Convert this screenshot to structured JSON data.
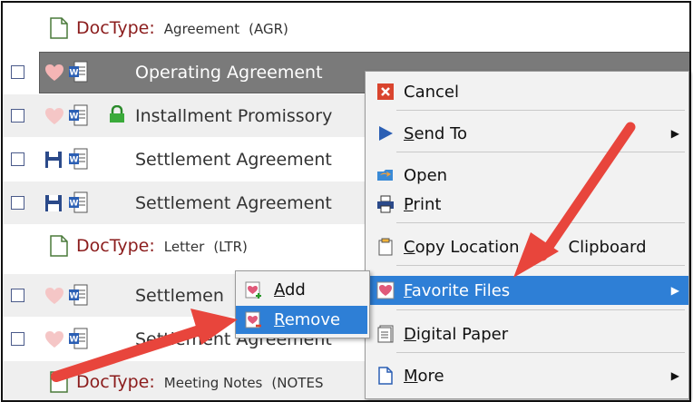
{
  "doctypes": [
    {
      "prefix": "DocType:",
      "name": "Agreement",
      "code": "(AGR)"
    },
    {
      "prefix": "DocType:",
      "name": "Letter",
      "code": "(LTR)"
    },
    {
      "prefix": "DocType:",
      "name": "Meeting Notes",
      "code": "(NOTES"
    }
  ],
  "files": [
    {
      "label": "Operating Agreement"
    },
    {
      "label": "Installment Promissory"
    },
    {
      "label": "Settlement Agreement"
    },
    {
      "label": "Settlement Agreement"
    },
    {
      "label": "Settlemen"
    },
    {
      "label": "Settlement Agreement"
    }
  ],
  "context_menu": {
    "cancel": "Cancel",
    "send_to_u": "S",
    "send_to_rest": "end To",
    "open": "Open",
    "print_u": "P",
    "print_rest": "rint",
    "copy_u": "C",
    "copy_rest": "opy Location",
    "copy_tail": "Clipboard",
    "favorites_u": "F",
    "favorites_rest": "avorite Files",
    "digital_u": "D",
    "digital_rest": "igital Paper",
    "more_u": "M",
    "more_rest": "ore"
  },
  "submenu": {
    "add_u": "A",
    "add_rest": "dd",
    "remove_u": "R",
    "remove_rest": "emove"
  },
  "colors": {
    "highlight": "#2e7fd6",
    "doctype_red": "#8b1c1c",
    "arrow_red": "#e8453c",
    "selected_row": "#7a7a7a"
  }
}
